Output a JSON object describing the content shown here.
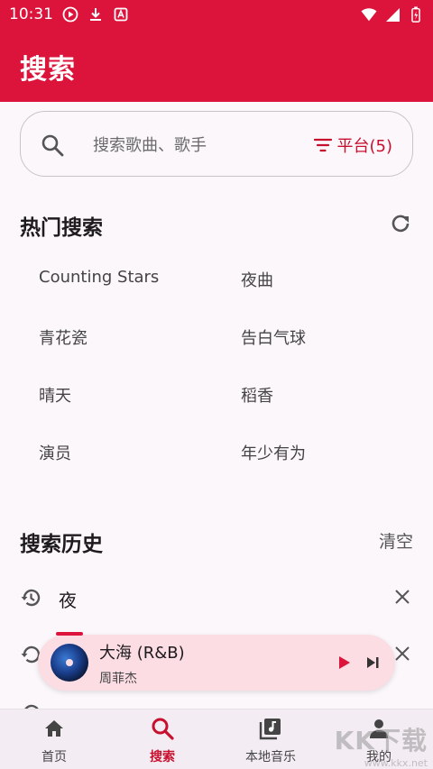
{
  "status_bar": {
    "time": "10:31"
  },
  "header": {
    "title": "搜索"
  },
  "search": {
    "placeholder": "搜索歌曲、歌手",
    "platform_label": "平台(5)"
  },
  "hot": {
    "title": "热门搜索",
    "items": [
      "Counting Stars",
      "夜曲",
      "青花瓷",
      "告白气球",
      "晴天",
      "稻香",
      "演员",
      "年少有为"
    ]
  },
  "history": {
    "title": "搜索历史",
    "clear_label": "清空",
    "items": [
      "夜"
    ]
  },
  "player": {
    "title": "大海 (R&B)",
    "artist": "周菲杰"
  },
  "nav": {
    "items": [
      {
        "label": "首页",
        "icon": "home-icon"
      },
      {
        "label": "搜索",
        "icon": "search-icon"
      },
      {
        "label": "本地音乐",
        "icon": "music-library-icon"
      },
      {
        "label": "我的",
        "icon": "person-icon"
      }
    ],
    "active_index": 1
  },
  "watermark": {
    "text": "KK下载",
    "url": "www.kkx.net"
  },
  "colors": {
    "primary": "#dc143c",
    "accent_text": "#c8102e",
    "player_bg": "#fbdde3"
  }
}
